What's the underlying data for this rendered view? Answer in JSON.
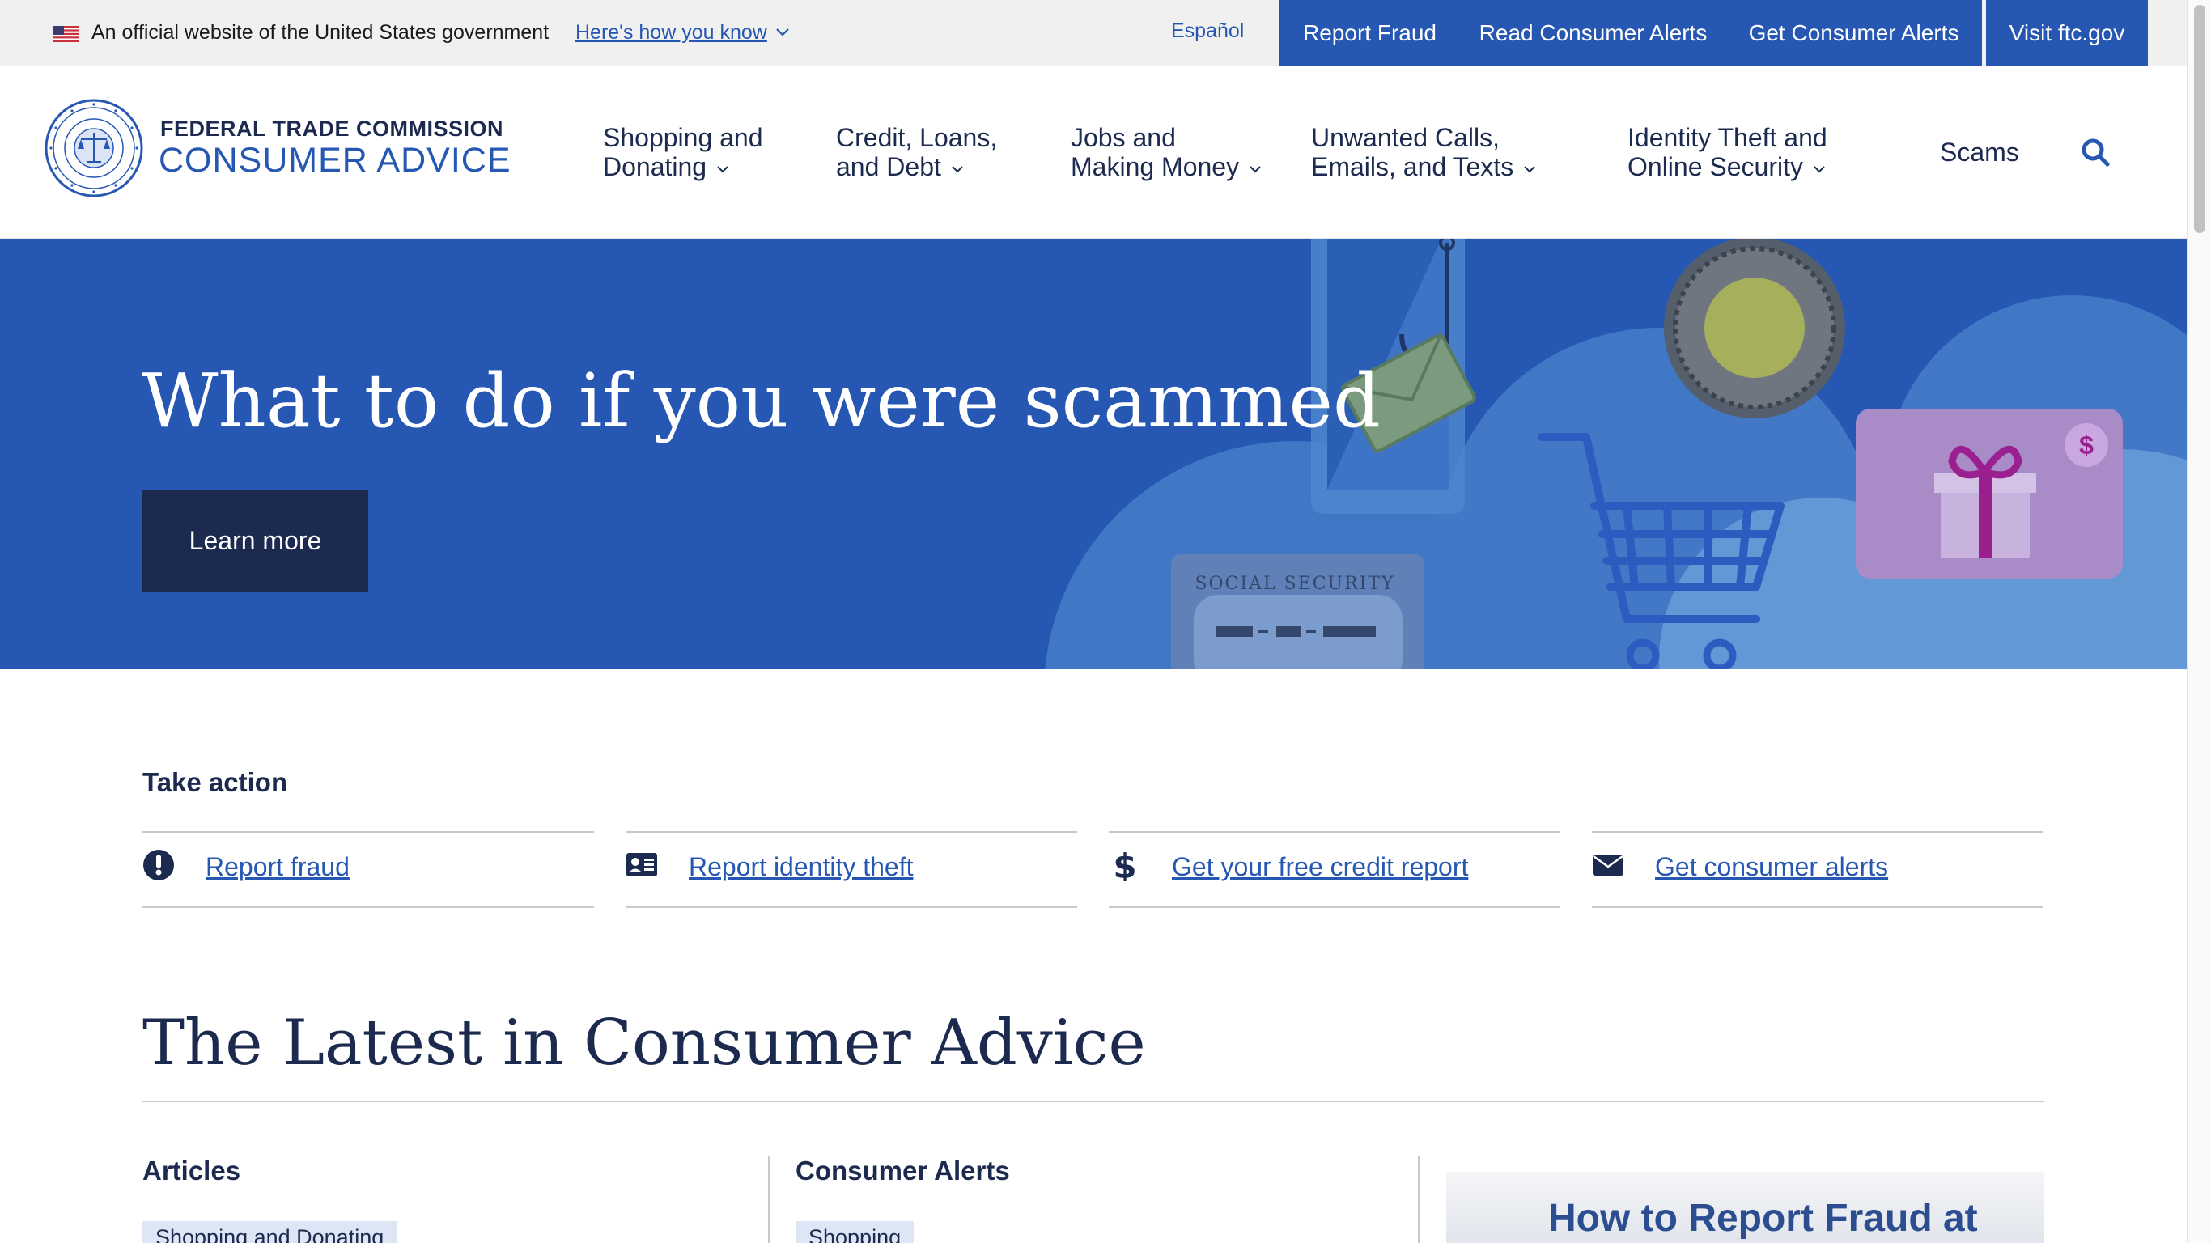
{
  "gov_banner": {
    "official_text": "An official website of the United States government",
    "how_link": "Here's how you know",
    "espanol": "Español"
  },
  "top_buttons": [
    "Report Fraud",
    "Read Consumer Alerts",
    "Get Consumer Alerts",
    "Visit ftc.gov"
  ],
  "header": {
    "org": "FEDERAL TRADE COMMISSION",
    "brand": "CONSUMER ADVICE",
    "nav": [
      {
        "line1": "Shopping and",
        "line2": "Donating"
      },
      {
        "line1": "Credit, Loans,",
        "line2": "and Debt"
      },
      {
        "line1": "Jobs and",
        "line2": "Making Money"
      },
      {
        "line1": "Unwanted Calls,",
        "line2": "Emails, and Texts"
      },
      {
        "line1": "Identity Theft and",
        "line2": "Online Security"
      }
    ],
    "scams": "Scams",
    "search_icon": "search-icon"
  },
  "hero": {
    "title": "What to do if you were scammed",
    "button": "Learn more",
    "card_label": "SOCIAL SECURITY"
  },
  "take_action": {
    "heading": "Take action",
    "items": [
      {
        "label": "Report fraud",
        "icon": "exclamation-circle-icon"
      },
      {
        "label": "Report identity theft",
        "icon": "id-card-icon"
      },
      {
        "label": "Get your free credit report",
        "icon": "dollar-icon"
      },
      {
        "label": "Get consumer alerts",
        "icon": "envelope-icon"
      }
    ]
  },
  "latest": {
    "title": "The Latest in Consumer Advice",
    "articles_heading": "Articles",
    "articles_tag": "Shopping and Donating",
    "alerts_heading": "Consumer Alerts",
    "alerts_tag": "Shopping",
    "promo_text": "How to Report Fraud at"
  },
  "colors": {
    "primary": "#2557b3",
    "navy": "#1b2a4e",
    "hero_bg": "#2557b3",
    "banner_bg": "#f0f0f0"
  }
}
